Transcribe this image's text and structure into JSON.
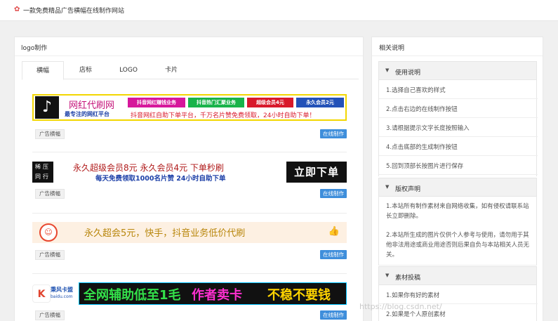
{
  "header": {
    "site_title": "一款免费精品广告横幅在线制作网站",
    "logo_icon": "flame-icon"
  },
  "left_panel": {
    "title": "logo制作",
    "tabs": [
      "横幅",
      "店标",
      "LOGO",
      "卡片"
    ],
    "active_tab": "横幅",
    "cards": [
      {
        "tag": "广告横幅",
        "button": "在线制作",
        "banner": {
          "logo_glyph": "♪",
          "headline": "网红代刷网",
          "chips": [
            "抖音网红赚钱业务",
            "抖音热门汇聚业务",
            "超级会员4元",
            "永久会员2元"
          ],
          "slogan": "最专注的网红平台",
          "subline": "抖音网红自助下单平台，千万名片赞免费领取，24小时自助下单！"
        }
      },
      {
        "tag": "广告横幅",
        "button": "在线制作",
        "banner": {
          "badge": "稀压 同行",
          "line1": "永久超级会员8元  永久会员4元  下单秒刷",
          "line2": "每天免费领取1000名片赞  24小时自助下单",
          "cta": "立即下单"
        }
      },
      {
        "tag": "广告横幅",
        "button": "在线制作",
        "banner": {
          "text": "永久超会5元，快手，抖音业务低价代刷"
        }
      },
      {
        "tag": "广告横幅",
        "button": "在线制作",
        "banner": {
          "logo_char": "K",
          "brand": "秉风卡盟",
          "domain": "baidu.com",
          "part1": "全网辅助低至1毛",
          "part2": "作者卖卡",
          "part3": "不稳不要钱"
        }
      }
    ]
  },
  "right_panel": {
    "title": "相关说明",
    "sections": [
      {
        "label": "使用说明",
        "items": [
          "1.选择自己喜欢的样式",
          "2.点击右边的在线制作按钮",
          "3.请根据提示文字长度按照输入",
          "4.点击底部的生成制作按钮",
          "5.回到顶部长按图片进行保存"
        ]
      },
      {
        "label": "版权声明",
        "paragraphs": [
          "1.本站所有制作素材来自网络收集，如有侵权请联系站长立即删除。",
          "2.本站所生成的图片仅供个人参考与使用，请勿用于其他非法用途或商业用途否则后果自负与本站相关人员无关。"
        ]
      },
      {
        "label": "素材投稿",
        "items": [
          "1.如果你有好的素材",
          "2.如果是个人原创素材"
        ]
      }
    ]
  },
  "watermark": "https://blog.csdn.net/"
}
